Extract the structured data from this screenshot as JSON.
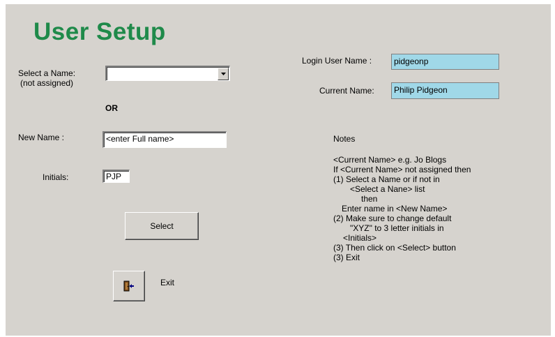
{
  "title": "User Setup",
  "select_name": {
    "label_line1": "Select a Name:",
    "label_line2": "(not assigned)",
    "value": ""
  },
  "or_label": "OR",
  "new_name": {
    "label": "New Name :",
    "value": "<enter Full name>"
  },
  "initials": {
    "label": "Initials:",
    "value": "PJP"
  },
  "select_button_label": "Select",
  "exit_label": "Exit",
  "login_user_name": {
    "label": "Login User Name :",
    "value": "pidgeonp"
  },
  "current_name": {
    "label": "Current Name:",
    "value": "Philip Pidgeon"
  },
  "notes": {
    "heading": "Notes",
    "lines": [
      "<Current Name> e.g. Jo Blogs",
      "If <Current Name> not assigned then",
      "(1) Select a Name or if not in",
      "<Select a Nane> list",
      "then",
      "Enter name in <New Name>",
      "(2) Make sure to change default",
      "\"XYZ\" to 3 letter initials in",
      "<Initials>",
      "(3) Then click on <Select> button",
      "(3) Exit"
    ]
  },
  "colors": {
    "title": "#1f8a4a",
    "form_background": "#d6d3ce",
    "readonly_field": "#a0d8e8"
  },
  "icons": {
    "combo": "chevron-down-icon",
    "exit": "exit-door-icon"
  }
}
